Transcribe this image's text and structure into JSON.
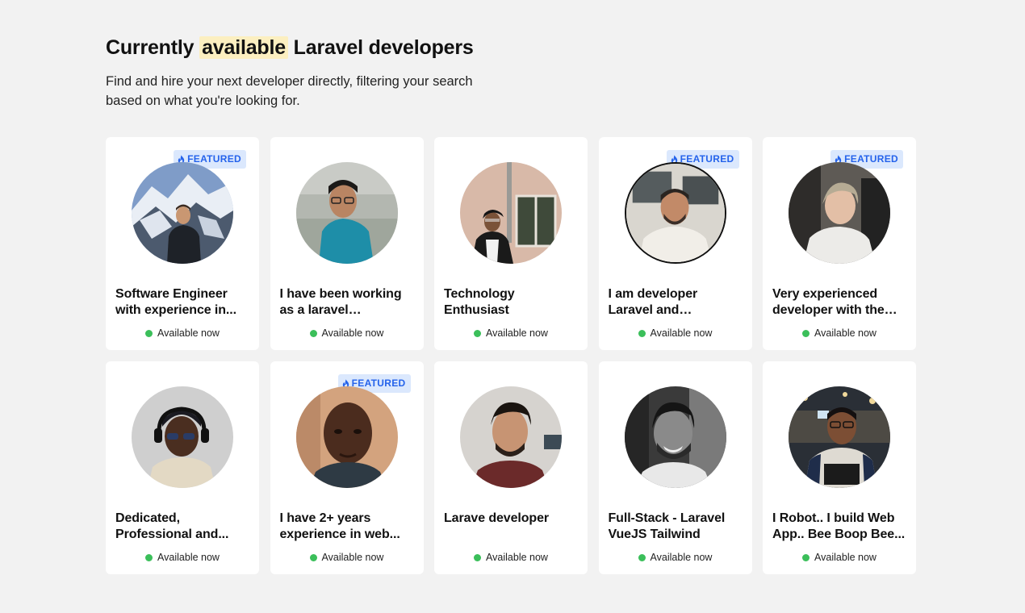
{
  "header": {
    "title_before": "Currently",
    "title_highlight": "available",
    "title_after": "Laravel developers",
    "subtitle": "Find and hire your next developer directly, filtering your search based on what you're looking for."
  },
  "colors": {
    "background": "#f2f2f2",
    "highlight": "#fcefc0",
    "badge_bg": "#dbe8fd",
    "badge_text": "#2563eb",
    "status_green": "#3bbf5a"
  },
  "badge_icon": "flame-icon",
  "cards": [
    {
      "title": "Software Engineer with experience in...",
      "featured": true,
      "badge": "FEATURED",
      "status": "Available now"
    },
    {
      "title": "I have been working as a laravel developer...",
      "featured": false,
      "badge": "",
      "status": "Available now"
    },
    {
      "title": "Technology Enthusiast",
      "featured": false,
      "badge": "",
      "status": "Available now"
    },
    {
      "title": "I am developer Laravel and accesibility",
      "featured": true,
      "badge": "FEATURED",
      "status": "Available now"
    },
    {
      "title": "Very experienced developer with the la...",
      "featured": true,
      "badge": "FEATURED",
      "status": "Available now"
    },
    {
      "title": "Dedicated, Professional and...",
      "featured": false,
      "badge": "",
      "status": "Available now"
    },
    {
      "title": "I have 2+ years experience in web...",
      "featured": true,
      "badge": "FEATURED",
      "status": "Available now"
    },
    {
      "title": "Larave developer",
      "featured": false,
      "badge": "",
      "status": "Available now"
    },
    {
      "title": "Full-Stack - Laravel VueJS Tailwind",
      "featured": false,
      "badge": "",
      "status": "Available now"
    },
    {
      "title": "I Robot.. I build Web App.. Bee Boop Bee...",
      "featured": false,
      "badge": "",
      "status": "Available now"
    }
  ]
}
